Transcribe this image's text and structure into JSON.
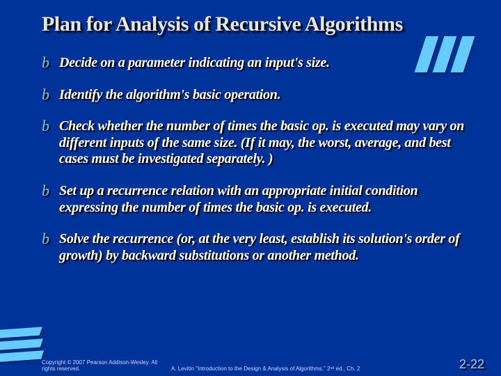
{
  "title": "Plan for Analysis of Recursive Algorithms",
  "bullets": [
    "Decide on  a parameter indicating an input's size.",
    "Identify the algorithm's basic operation.",
    "Check whether the number of times the basic op. is executed may vary on different inputs of the same size.  (If it may, the worst, average, and best cases must be investigated separately. )",
    "Set up a recurrence relation with an appropriate initial condition expressing the number of times the basic op. is executed.",
    "Solve the recurrence (or, at the very least, establish its solution's order of growth) by backward substitutions or another method."
  ],
  "footer": {
    "copyright": "Copyright © 2007 Pearson Addison-Wesley. All rights reserved.",
    "citation": "A. Levitin \"Introduction to the Design & Analysis of Algorithms,\" 2ⁿᵈ ed., Ch. 2",
    "page": "2-22"
  },
  "decor": {
    "bullet_glyph": "b",
    "accent_color": "#66ccff",
    "background_color": "#003399"
  }
}
